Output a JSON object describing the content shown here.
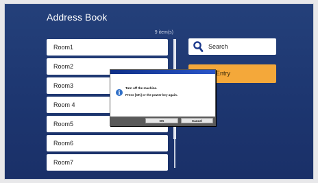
{
  "header": {
    "title": "Address Book",
    "item_count": "9 item(s)"
  },
  "list": {
    "items": [
      {
        "label": "Room1"
      },
      {
        "label": "Room2"
      },
      {
        "label": "Room3"
      },
      {
        "label": "Room 4"
      },
      {
        "label": "Room5"
      },
      {
        "label": "Room6"
      },
      {
        "label": "Room7"
      }
    ]
  },
  "actions": {
    "search_label": "Search",
    "manual_entry_label": "Manual Entry"
  },
  "dialog": {
    "line1": "Turn off the machine.",
    "line2": "Press [OK] or the power key again.",
    "ok_label": "OK",
    "cancel_label": "Cancel",
    "icon": "info-icon"
  },
  "colors": {
    "background": "#1d3670",
    "accent_orange": "#f4a83a"
  }
}
